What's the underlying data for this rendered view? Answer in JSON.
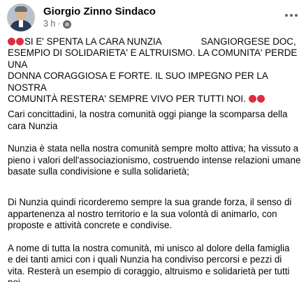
{
  "post": {
    "author": "Giorgio Zinno Sindaco",
    "time": "3 h",
    "separator": "·",
    "headline_part1": "SI E' SPENTA LA CARA NUNZIA",
    "headline_part2": "SANGIORGESE DOC,",
    "headline_line2": "ESEMPIO DI SOLIDARIETA' E ALTRUISMO. LA COMUNITA' PERDE UNA",
    "headline_line3": "DONNA CORAGGIOSA E FORTE. IL SUO IMPEGNO PER LA NOSTRA",
    "headline_line4": "COMUNITÀ RESTERA' SEMPRE VIVO PER TUTTI NOI.",
    "p1_line1": "Cari concittadini, la nostra comunità oggi piange la scomparsa della",
    "p1_line2": "cara Nunzia",
    "p2_line1": "Nunzia è stata nella nostra comunità sempre molto attiva; ha vissuto a",
    "p2_line2": "pieno i valori dell'associazionismo, costruendo intense relazioni umane",
    "p2_line3": "basate sulla condivisione e sulla solidarietà;",
    "p3_line1": "Di Nunzia quindi ricorderemo sempre la sua grande forza, il senso di",
    "p3_line2": "appartenenza  al nostro territorio e la sua volontà di animarlo, con",
    "p3_line3": "proposte e attività concrete e condivise.",
    "p4_line1": "A nome di tutta la nostra comunità, mi unisco al dolore della famiglia",
    "p4_line2": "e dei tanti amici con i quali Nunzia ha condiviso percorsi e pezzi di",
    "p4_line3": "vita. Resterà un esempio di coraggio, altruismo e solidarietà per tutti",
    "p4_line4": "noi"
  },
  "icons": {
    "emoji": "red-circle-emoji",
    "audience": "globe-icon",
    "menu": "more-options-icon"
  },
  "colors": {
    "text": "#050505",
    "secondary": "#65676b",
    "red_circle": "#dd2e44"
  }
}
